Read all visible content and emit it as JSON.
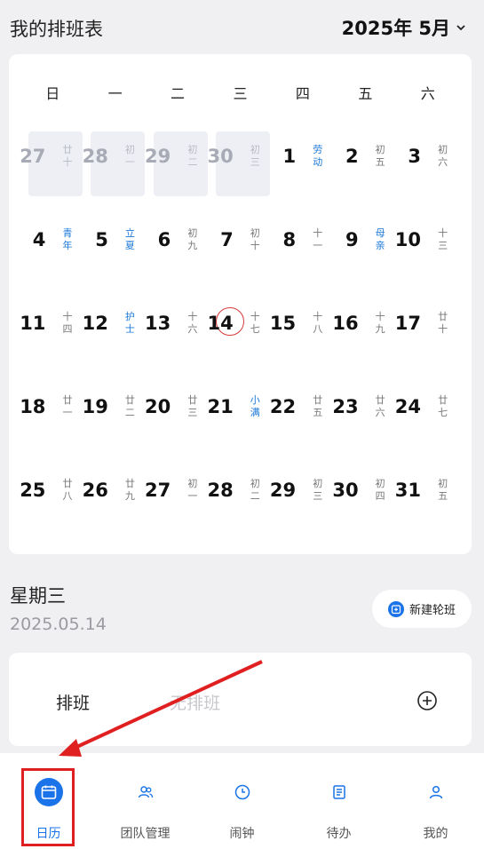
{
  "header": {
    "title": "我的排班表",
    "month": "2025年 5月"
  },
  "calendar": {
    "weekdays": [
      "日",
      "一",
      "二",
      "三",
      "四",
      "五",
      "六"
    ],
    "days": [
      {
        "day": "27",
        "lunar": "廿十",
        "other": true
      },
      {
        "day": "28",
        "lunar": "初一",
        "other": true
      },
      {
        "day": "29",
        "lunar": "初二",
        "other": true
      },
      {
        "day": "30",
        "lunar": "初三",
        "other": true
      },
      {
        "day": "1",
        "lunar": "劳动",
        "festival": true
      },
      {
        "day": "2",
        "lunar": "初五"
      },
      {
        "day": "3",
        "lunar": "初六"
      },
      {
        "day": "4",
        "lunar": "青年",
        "festival": true
      },
      {
        "day": "5",
        "lunar": "立夏",
        "festival": true
      },
      {
        "day": "6",
        "lunar": "初九"
      },
      {
        "day": "7",
        "lunar": "初十"
      },
      {
        "day": "8",
        "lunar": "十一"
      },
      {
        "day": "9",
        "lunar": "母亲",
        "festival": true
      },
      {
        "day": "10",
        "lunar": "十三"
      },
      {
        "day": "11",
        "lunar": "十四"
      },
      {
        "day": "12",
        "lunar": "护士",
        "festival": true
      },
      {
        "day": "13",
        "lunar": "十六"
      },
      {
        "day": "14",
        "lunar": "十七",
        "today": true
      },
      {
        "day": "15",
        "lunar": "十八"
      },
      {
        "day": "16",
        "lunar": "十九"
      },
      {
        "day": "17",
        "lunar": "廿十"
      },
      {
        "day": "18",
        "lunar": "廿一"
      },
      {
        "day": "19",
        "lunar": "廿二"
      },
      {
        "day": "20",
        "lunar": "廿三"
      },
      {
        "day": "21",
        "lunar": "小满",
        "festival": true
      },
      {
        "day": "22",
        "lunar": "廿五"
      },
      {
        "day": "23",
        "lunar": "廿六"
      },
      {
        "day": "24",
        "lunar": "廿七"
      },
      {
        "day": "25",
        "lunar": "廿八"
      },
      {
        "day": "26",
        "lunar": "廿九"
      },
      {
        "day": "27",
        "lunar": "初一"
      },
      {
        "day": "28",
        "lunar": "初二"
      },
      {
        "day": "29",
        "lunar": "初三"
      },
      {
        "day": "30",
        "lunar": "初四"
      },
      {
        "day": "31",
        "lunar": "初五"
      }
    ]
  },
  "selected": {
    "weekday": "星期三",
    "date": "2025.05.14",
    "new_rotation_label": "新建轮班"
  },
  "shift": {
    "label": "排班",
    "value": "无排班"
  },
  "tabbar": {
    "tabs": [
      {
        "label": "日历",
        "icon": "calendar-icon",
        "active": true
      },
      {
        "label": "团队管理",
        "icon": "team-icon"
      },
      {
        "label": "闹钟",
        "icon": "clock-icon"
      },
      {
        "label": "待办",
        "icon": "todo-icon"
      },
      {
        "label": "我的",
        "icon": "user-icon"
      }
    ]
  },
  "colors": {
    "accent": "#1a73e8",
    "festival": "#1977d8",
    "today_ring": "#d83a3a",
    "annotation": "#e02020"
  }
}
